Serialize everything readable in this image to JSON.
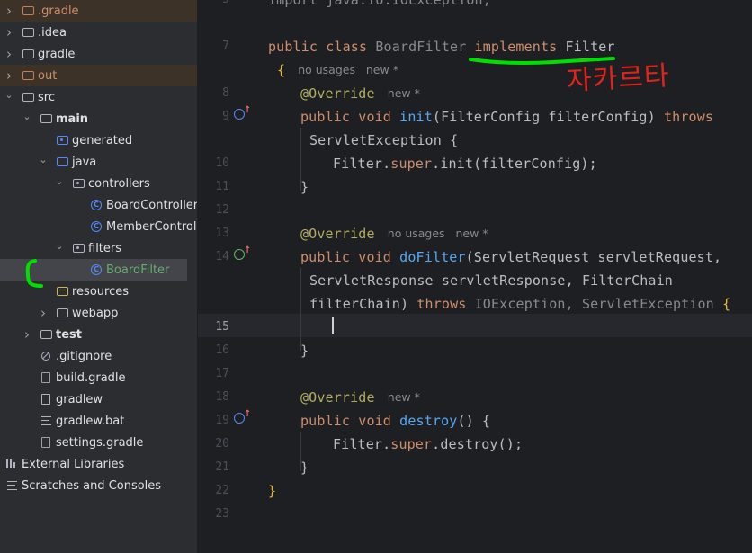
{
  "tree": {
    "items": [
      {
        "label": ".gradle",
        "level": 0,
        "chevron": "right",
        "icon": "folder-orange",
        "excluded": true,
        "bold": false
      },
      {
        "label": ".idea",
        "level": 0,
        "chevron": "right",
        "icon": "folder",
        "excluded": false,
        "bold": false
      },
      {
        "label": "gradle",
        "level": 0,
        "chevron": "right",
        "icon": "folder",
        "excluded": false,
        "bold": false
      },
      {
        "label": "out",
        "level": 0,
        "chevron": "right",
        "icon": "folder-orange",
        "excluded": true,
        "bold": false
      },
      {
        "label": "src",
        "level": 0,
        "chevron": "down",
        "icon": "folder",
        "excluded": false,
        "bold": false
      },
      {
        "label": "main",
        "level": 1,
        "chevron": "down",
        "icon": "folder",
        "excluded": false,
        "bold": true
      },
      {
        "label": "generated",
        "level": 2,
        "chevron": "",
        "icon": "folder-generated",
        "excluded": false,
        "bold": false
      },
      {
        "label": "java",
        "level": 2,
        "chevron": "down",
        "icon": "folder-blue",
        "excluded": false,
        "bold": false
      },
      {
        "label": "controllers",
        "level": 3,
        "chevron": "down",
        "icon": "package",
        "excluded": false,
        "bold": false
      },
      {
        "label": "BoardController",
        "level": 4,
        "chevron": "",
        "icon": "class",
        "excluded": false,
        "bold": false
      },
      {
        "label": "MemberController",
        "level": 4,
        "chevron": "",
        "icon": "class",
        "excluded": false,
        "bold": false
      },
      {
        "label": "filters",
        "level": 3,
        "chevron": "down",
        "icon": "package",
        "excluded": false,
        "bold": false
      },
      {
        "label": "BoardFilter",
        "level": 4,
        "chevron": "",
        "icon": "class",
        "excluded": false,
        "bold": false,
        "selected": true
      },
      {
        "label": "resources",
        "level": 2,
        "chevron": "",
        "icon": "folder-resources",
        "excluded": false,
        "bold": false
      },
      {
        "label": "webapp",
        "level": 2,
        "chevron": "right",
        "icon": "folder",
        "excluded": false,
        "bold": false
      },
      {
        "label": "test",
        "level": 1,
        "chevron": "right",
        "icon": "folder",
        "excluded": false,
        "bold": true
      },
      {
        "label": ".gitignore",
        "level": 1,
        "chevron": "",
        "icon": "gitignore",
        "excluded": false,
        "bold": false
      },
      {
        "label": "build.gradle",
        "level": 1,
        "chevron": "",
        "icon": "gradle-file",
        "excluded": false,
        "bold": false
      },
      {
        "label": "gradlew",
        "level": 1,
        "chevron": "",
        "icon": "file",
        "excluded": false,
        "bold": false
      },
      {
        "label": "gradlew.bat",
        "level": 1,
        "chevron": "",
        "icon": "text-file",
        "excluded": false,
        "bold": false
      },
      {
        "label": "settings.gradle",
        "level": 1,
        "chevron": "",
        "icon": "gradle-file",
        "excluded": false,
        "bold": false
      },
      {
        "label": "External Libraries",
        "level": 0,
        "chevron": "",
        "icon": "libraries",
        "excluded": false,
        "bold": false
      },
      {
        "label": "Scratches and Consoles",
        "level": 0,
        "chevron": "",
        "icon": "scratches",
        "excluded": false,
        "bold": false
      }
    ]
  },
  "editor": {
    "current_line": "15",
    "lines": [
      {
        "num": "5",
        "spans": [
          {
            "t": "import java.io.IOException;",
            "c": "dim"
          }
        ]
      },
      {
        "num": "",
        "spans": []
      },
      {
        "num": "7",
        "spans": [
          {
            "t": "public ",
            "c": "kw"
          },
          {
            "t": "class ",
            "c": "kw"
          },
          {
            "t": "BoardFilter ",
            "c": "dim"
          },
          {
            "t": "implements ",
            "c": "kw"
          },
          {
            "t": "Filter",
            "c": ""
          }
        ]
      },
      {
        "num": "",
        "spans": [
          {
            "t": "{",
            "c": "brace"
          }
        ],
        "hint": "no usages   new *"
      },
      {
        "num": "8",
        "spans": [
          {
            "t": "@Override",
            "c": "an"
          }
        ],
        "hint": "new *"
      },
      {
        "num": "9",
        "spans": [
          {
            "t": "public ",
            "c": "kw"
          },
          {
            "t": "void ",
            "c": "kw"
          },
          {
            "t": "init",
            "c": "fn"
          },
          {
            "t": "(FilterConfig filterConfig) ",
            "c": ""
          },
          {
            "t": "throws",
            "c": "kw"
          }
        ]
      },
      {
        "num": "",
        "spans": [
          {
            "t": "ServletException {",
            "c": ""
          }
        ]
      },
      {
        "num": "10",
        "spans": [
          {
            "t": "Filter.",
            "c": ""
          },
          {
            "t": "super",
            "c": "kw"
          },
          {
            "t": ".init(filterConfig);",
            "c": ""
          }
        ]
      },
      {
        "num": "11",
        "spans": [
          {
            "t": "}",
            "c": ""
          }
        ]
      },
      {
        "num": "12",
        "spans": []
      },
      {
        "num": "13",
        "spans": [
          {
            "t": "@Override",
            "c": "an"
          }
        ],
        "hint": "no usages   new *"
      },
      {
        "num": "14",
        "spans": [
          {
            "t": "public ",
            "c": "kw"
          },
          {
            "t": "void ",
            "c": "kw"
          },
          {
            "t": "doFilter",
            "c": "fn"
          },
          {
            "t": "(ServletRequest servletRequest,",
            "c": ""
          }
        ]
      },
      {
        "num": "",
        "spans": [
          {
            "t": "ServletResponse servletResponse, FilterChain",
            "c": ""
          }
        ]
      },
      {
        "num": "",
        "spans": [
          {
            "t": "filterChain) ",
            "c": ""
          },
          {
            "t": "throws ",
            "c": "kw"
          },
          {
            "t": "IOException, ServletException ",
            "c": "dim"
          },
          {
            "t": "{",
            "c": "brace"
          }
        ]
      },
      {
        "num": "15",
        "spans": []
      },
      {
        "num": "16",
        "spans": [
          {
            "t": "}",
            "c": ""
          }
        ]
      },
      {
        "num": "17",
        "spans": []
      },
      {
        "num": "18",
        "spans": [
          {
            "t": "@Override",
            "c": "an"
          }
        ],
        "hint": "new *"
      },
      {
        "num": "19",
        "spans": [
          {
            "t": "public ",
            "c": "kw"
          },
          {
            "t": "void ",
            "c": "kw"
          },
          {
            "t": "destroy",
            "c": "fn"
          },
          {
            "t": "() {",
            "c": ""
          }
        ]
      },
      {
        "num": "20",
        "spans": [
          {
            "t": "Filter.",
            "c": ""
          },
          {
            "t": "super",
            "c": "kw"
          },
          {
            "t": ".destroy();",
            "c": ""
          }
        ]
      },
      {
        "num": "21",
        "spans": [
          {
            "t": "}",
            "c": ""
          }
        ]
      },
      {
        "num": "22",
        "spans": [
          {
            "t": "}",
            "c": "brace"
          }
        ]
      },
      {
        "num": "23",
        "spans": []
      }
    ]
  },
  "annotation": {
    "korean_text": "자카르타",
    "ink_color_red": "#e0241d",
    "ink_color_green": "#00e000"
  },
  "colors": {
    "keyword": "#cf8e6d",
    "function": "#56a8f5",
    "annotation": "#b3ae60",
    "text": "#bcbec4",
    "brace": "#e8ba36"
  }
}
